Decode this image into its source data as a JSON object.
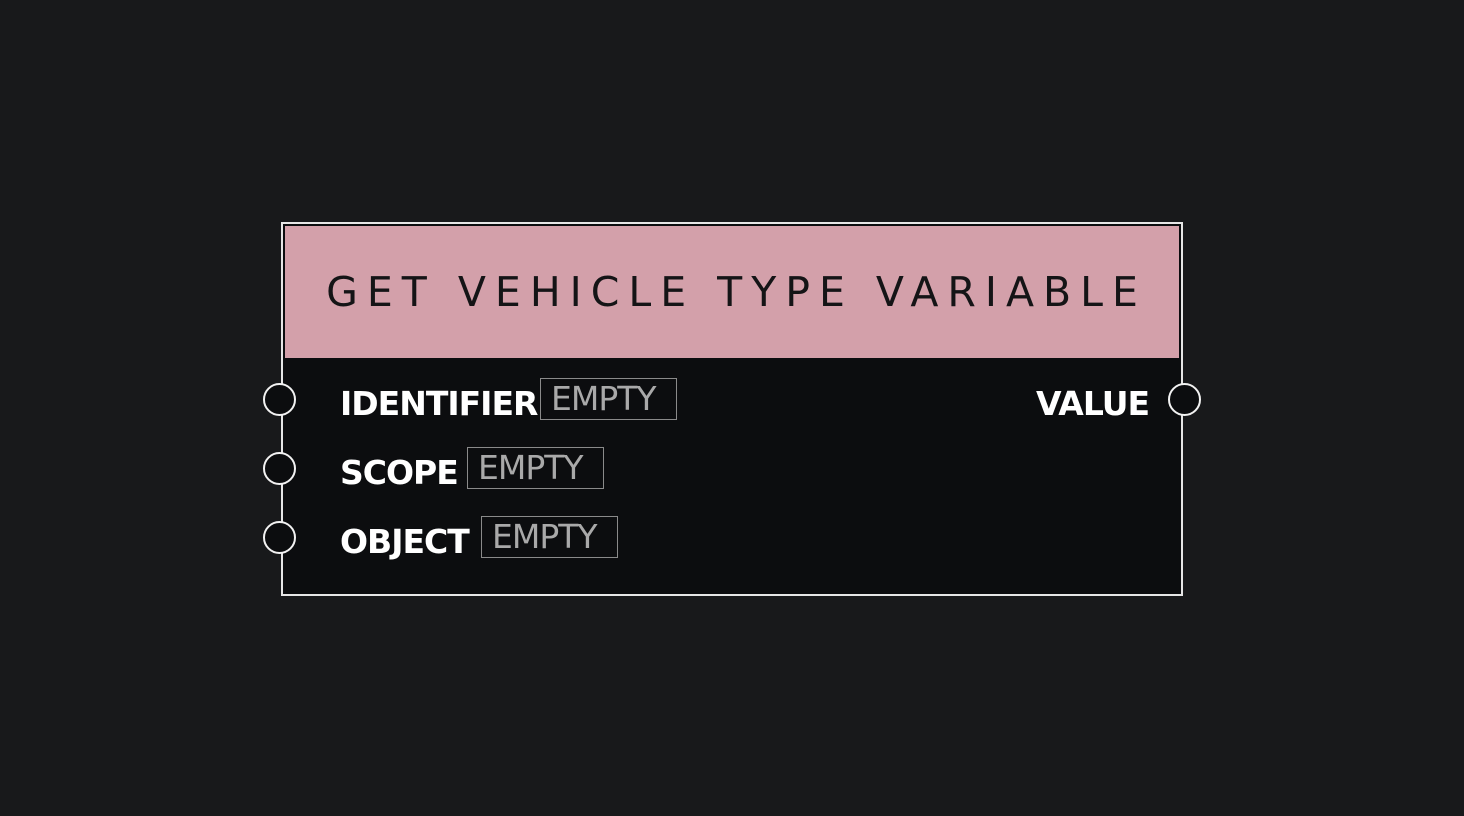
{
  "node": {
    "title": "GET VEHICLE TYPE VARIABLE",
    "header_color": "#d3a0aa",
    "inputs": [
      {
        "label": "IDENTIFIER",
        "value": "EMPTY"
      },
      {
        "label": "SCOPE",
        "value": "EMPTY"
      },
      {
        "label": "OBJECT",
        "value": "EMPTY"
      }
    ],
    "outputs": [
      {
        "label": "VALUE"
      }
    ]
  }
}
